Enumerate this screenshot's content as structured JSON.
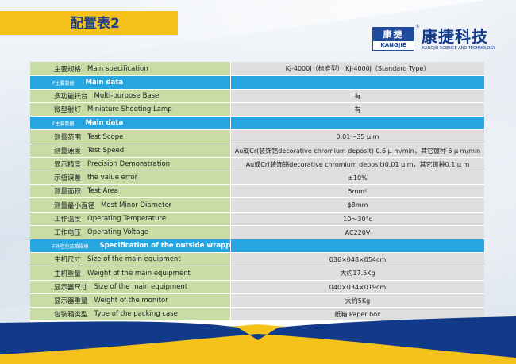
{
  "header": {
    "title": "配置表2"
  },
  "logo": {
    "small_cn": "康捷",
    "small_en": "KANGJIE",
    "brand_cn": "康捷科技",
    "brand_en": "KANGJIE SCIENCE AND TECHNOLOGY",
    "registered": "®"
  },
  "rows": [
    {
      "type": "row",
      "cn": "主要规格",
      "en": "Main specification",
      "value": "KJ-4000J（标准型） KJ-4000J（Standard Type）"
    },
    {
      "type": "section",
      "cn": "F主要数据",
      "en": "Main data"
    },
    {
      "type": "row",
      "cn": "多功能托台",
      "en": "Multi-purpose Base",
      "value": "有"
    },
    {
      "type": "row",
      "cn": "微型射灯",
      "en": "Miniature Shooting Lamp",
      "value": "有"
    },
    {
      "type": "section",
      "cn": "F主要数据",
      "en": "Main data"
    },
    {
      "type": "row",
      "cn": "测量范围",
      "en": "Test Scope",
      "value": "0.01～35 μ m"
    },
    {
      "type": "row",
      "cn": "测量速度",
      "en": "Test Speed",
      "value": "Au或Cr(装饰铬decorative chromium deposit)  0.6 μ m/min，其它镀种 6 μ m/min"
    },
    {
      "type": "row",
      "cn": "显示精度",
      "en": "Precision Demonstration",
      "value": "Au或Cr(装饰铬decorative chromium deposit)0.01 μ m，其它镀种0.1 μ m"
    },
    {
      "type": "row",
      "cn": "示值误差",
      "en": "the value error",
      "value": "±10%"
    },
    {
      "type": "row",
      "cn": "测量面积",
      "en": "Test Area",
      "value": "5mm²"
    },
    {
      "type": "row",
      "cn": "测量最小直径",
      "en": "Most Minor Diameter",
      "value": "ϕ8mm"
    },
    {
      "type": "row",
      "cn": "工作温度",
      "en": "Operating Temperature",
      "value": "10～30°c"
    },
    {
      "type": "row",
      "cn": "工作电压",
      "en": "Operating Voltage",
      "value": "AC220V"
    },
    {
      "type": "section",
      "cn": "F外型包装箱规格",
      "en": "Specification of the outside wrapping box"
    },
    {
      "type": "row",
      "cn": "主机尺寸",
      "en": "Size of the main equipment",
      "value": "036×048×054cm"
    },
    {
      "type": "row",
      "cn": "主机重量",
      "en": "Weight of the main equipment",
      "value": "大约17.5Kg"
    },
    {
      "type": "row",
      "cn": "显示器尺寸",
      "en": "Size of the main equipment",
      "value": "040×034×019cm"
    },
    {
      "type": "row",
      "cn": "显示器重量",
      "en": "Weight of the monitor",
      "value": "大约5Kg"
    },
    {
      "type": "row",
      "cn": "包装箱类型",
      "en": "Type of the packing case",
      "value": "纸箱   Paper box"
    }
  ],
  "colors": {
    "title_bar": "#f5c21b",
    "title_text": "#1f3f8f",
    "label_bg": "#c8dca6",
    "value_bg": "#dedede",
    "section_bg": "#25a6e0",
    "navy": "#123a8a"
  }
}
